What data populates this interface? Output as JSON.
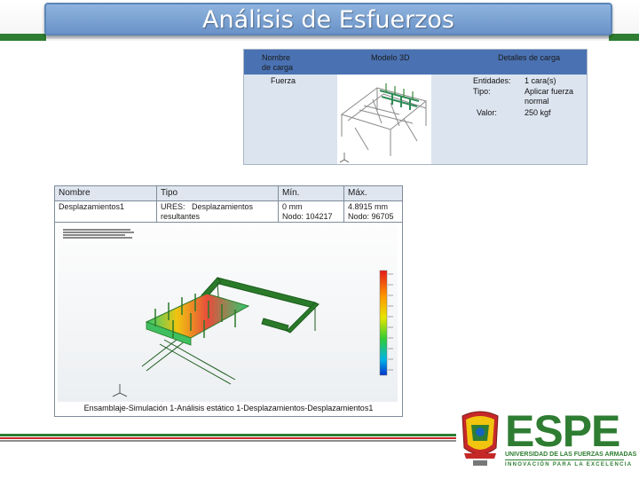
{
  "slide": {
    "title": "Análisis de Esfuerzos"
  },
  "load_table": {
    "headers": {
      "name": "Nombre\nde carga",
      "model": "Modelo 3D",
      "details": "Detalles de carga"
    },
    "row": {
      "name": "Fuerza",
      "details": [
        {
          "label": "Entidades:",
          "value": "1 cara(s)"
        },
        {
          "label": "Tipo:",
          "value": "Aplicar fuerza\nnormal"
        },
        {
          "label": "Valor:",
          "value": "250 kgf"
        }
      ]
    }
  },
  "results_table": {
    "headers": {
      "name": "Nombre",
      "type": "Tipo",
      "min": "Mín.",
      "max": "Máx."
    },
    "row": {
      "name": "Desplazamientos1",
      "type": "URES:   Desplazamientos\nresultantes",
      "min": "0 mm\nNodo: 104217",
      "max": "4.8915 mm\nNodo: 96705"
    },
    "caption": "Ensamblaje-Simulación 1-Análisis estático 1-Desplazamientos-Desplazamientos1"
  },
  "logo": {
    "wordmark": "ESPE",
    "subtitle": "UNIVERSIDAD DE LAS FUERZAS ARMADAS",
    "tagline": "INNOVACIÓN PARA LA EXCELENCIA"
  },
  "colors": {
    "title_bg": "#7aa0d2",
    "table_header": "#4a72b3",
    "brand_green": "#2e7d32",
    "brand_red": "#c62828"
  }
}
